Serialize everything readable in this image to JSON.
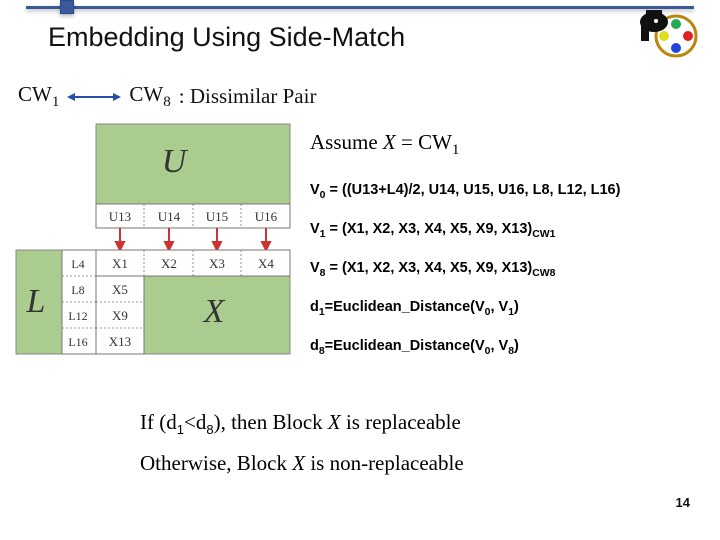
{
  "slide": {
    "title": "Embedding Using Side-Match",
    "page_number": "14"
  },
  "pair": {
    "left": "CW",
    "left_sub": "1",
    "right": "CW",
    "right_sub": "8",
    "desc": " : Dissimilar Pair"
  },
  "assume": {
    "prefix": "Assume ",
    "var": "X",
    "eq": " = CW",
    "sub": "1"
  },
  "eqs": {
    "v0pre": "V",
    "v0sub": "0",
    "v0post": " = ((U13+L4)/2, U14, U15, U16, L8, L12, L16)",
    "v1pre": "V",
    "v1sub": "1",
    "v1post": " = (X1, X2, X3, X4, X5, X9, X13)",
    "v1tail": "CW1",
    "v8pre": "V",
    "v8sub": "8",
    "v8post": " = (X1, X2, X3, X4, X5, X9, X13)",
    "v8tail": "CW8",
    "d1pre": "d",
    "d1sub": "1",
    "d1post": "=Euclidean_Distance(V",
    "d1a": "0",
    "d1mid": ", V",
    "d1b": "1",
    "d1end": ")",
    "d8pre": "d",
    "d8sub": "8",
    "d8post": "=Euclidean_Distance(V",
    "d8a": "0",
    "d8mid": ", V",
    "d8b": "8",
    "d8end": ")"
  },
  "concl": {
    "l1a": "If (d",
    "l1s1": "1",
    "l1b": "<d",
    "l1s2": "8",
    "l1c": "), then Block ",
    "l1var": "X",
    "l1d": " is replaceable",
    "l2a": "Otherwise, Block ",
    "l2var": "X",
    "l2b": " is non-replaceable"
  },
  "diagram": {
    "U": "U",
    "L": "L",
    "X": "X",
    "row_u": [
      "U13",
      "U14",
      "U15",
      "U16"
    ],
    "col_l": [
      "L4",
      "L8",
      "L12",
      "L16"
    ],
    "xcells": [
      [
        "X1",
        "X2",
        "X3",
        "X4"
      ],
      [
        "X5",
        "",
        "",
        ""
      ],
      [
        "X9",
        "",
        "",
        ""
      ],
      [
        "X13",
        "",
        "",
        ""
      ]
    ]
  }
}
